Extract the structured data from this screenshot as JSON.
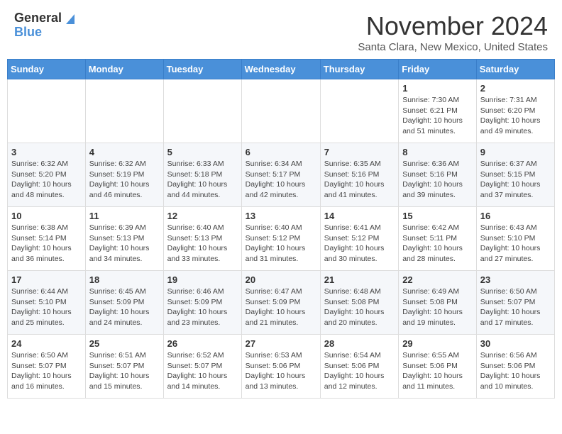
{
  "header": {
    "logo_line1": "General",
    "logo_line2": "Blue",
    "month": "November 2024",
    "location": "Santa Clara, New Mexico, United States"
  },
  "weekdays": [
    "Sunday",
    "Monday",
    "Tuesday",
    "Wednesday",
    "Thursday",
    "Friday",
    "Saturday"
  ],
  "weeks": [
    [
      {
        "day": "",
        "info": ""
      },
      {
        "day": "",
        "info": ""
      },
      {
        "day": "",
        "info": ""
      },
      {
        "day": "",
        "info": ""
      },
      {
        "day": "",
        "info": ""
      },
      {
        "day": "1",
        "info": "Sunrise: 7:30 AM\nSunset: 6:21 PM\nDaylight: 10 hours\nand 51 minutes."
      },
      {
        "day": "2",
        "info": "Sunrise: 7:31 AM\nSunset: 6:20 PM\nDaylight: 10 hours\nand 49 minutes."
      }
    ],
    [
      {
        "day": "3",
        "info": "Sunrise: 6:32 AM\nSunset: 5:20 PM\nDaylight: 10 hours\nand 48 minutes."
      },
      {
        "day": "4",
        "info": "Sunrise: 6:32 AM\nSunset: 5:19 PM\nDaylight: 10 hours\nand 46 minutes."
      },
      {
        "day": "5",
        "info": "Sunrise: 6:33 AM\nSunset: 5:18 PM\nDaylight: 10 hours\nand 44 minutes."
      },
      {
        "day": "6",
        "info": "Sunrise: 6:34 AM\nSunset: 5:17 PM\nDaylight: 10 hours\nand 42 minutes."
      },
      {
        "day": "7",
        "info": "Sunrise: 6:35 AM\nSunset: 5:16 PM\nDaylight: 10 hours\nand 41 minutes."
      },
      {
        "day": "8",
        "info": "Sunrise: 6:36 AM\nSunset: 5:16 PM\nDaylight: 10 hours\nand 39 minutes."
      },
      {
        "day": "9",
        "info": "Sunrise: 6:37 AM\nSunset: 5:15 PM\nDaylight: 10 hours\nand 37 minutes."
      }
    ],
    [
      {
        "day": "10",
        "info": "Sunrise: 6:38 AM\nSunset: 5:14 PM\nDaylight: 10 hours\nand 36 minutes."
      },
      {
        "day": "11",
        "info": "Sunrise: 6:39 AM\nSunset: 5:13 PM\nDaylight: 10 hours\nand 34 minutes."
      },
      {
        "day": "12",
        "info": "Sunrise: 6:40 AM\nSunset: 5:13 PM\nDaylight: 10 hours\nand 33 minutes."
      },
      {
        "day": "13",
        "info": "Sunrise: 6:40 AM\nSunset: 5:12 PM\nDaylight: 10 hours\nand 31 minutes."
      },
      {
        "day": "14",
        "info": "Sunrise: 6:41 AM\nSunset: 5:12 PM\nDaylight: 10 hours\nand 30 minutes."
      },
      {
        "day": "15",
        "info": "Sunrise: 6:42 AM\nSunset: 5:11 PM\nDaylight: 10 hours\nand 28 minutes."
      },
      {
        "day": "16",
        "info": "Sunrise: 6:43 AM\nSunset: 5:10 PM\nDaylight: 10 hours\nand 27 minutes."
      }
    ],
    [
      {
        "day": "17",
        "info": "Sunrise: 6:44 AM\nSunset: 5:10 PM\nDaylight: 10 hours\nand 25 minutes."
      },
      {
        "day": "18",
        "info": "Sunrise: 6:45 AM\nSunset: 5:09 PM\nDaylight: 10 hours\nand 24 minutes."
      },
      {
        "day": "19",
        "info": "Sunrise: 6:46 AM\nSunset: 5:09 PM\nDaylight: 10 hours\nand 23 minutes."
      },
      {
        "day": "20",
        "info": "Sunrise: 6:47 AM\nSunset: 5:09 PM\nDaylight: 10 hours\nand 21 minutes."
      },
      {
        "day": "21",
        "info": "Sunrise: 6:48 AM\nSunset: 5:08 PM\nDaylight: 10 hours\nand 20 minutes."
      },
      {
        "day": "22",
        "info": "Sunrise: 6:49 AM\nSunset: 5:08 PM\nDaylight: 10 hours\nand 19 minutes."
      },
      {
        "day": "23",
        "info": "Sunrise: 6:50 AM\nSunset: 5:07 PM\nDaylight: 10 hours\nand 17 minutes."
      }
    ],
    [
      {
        "day": "24",
        "info": "Sunrise: 6:50 AM\nSunset: 5:07 PM\nDaylight: 10 hours\nand 16 minutes."
      },
      {
        "day": "25",
        "info": "Sunrise: 6:51 AM\nSunset: 5:07 PM\nDaylight: 10 hours\nand 15 minutes."
      },
      {
        "day": "26",
        "info": "Sunrise: 6:52 AM\nSunset: 5:07 PM\nDaylight: 10 hours\nand 14 minutes."
      },
      {
        "day": "27",
        "info": "Sunrise: 6:53 AM\nSunset: 5:06 PM\nDaylight: 10 hours\nand 13 minutes."
      },
      {
        "day": "28",
        "info": "Sunrise: 6:54 AM\nSunset: 5:06 PM\nDaylight: 10 hours\nand 12 minutes."
      },
      {
        "day": "29",
        "info": "Sunrise: 6:55 AM\nSunset: 5:06 PM\nDaylight: 10 hours\nand 11 minutes."
      },
      {
        "day": "30",
        "info": "Sunrise: 6:56 AM\nSunset: 5:06 PM\nDaylight: 10 hours\nand 10 minutes."
      }
    ]
  ]
}
